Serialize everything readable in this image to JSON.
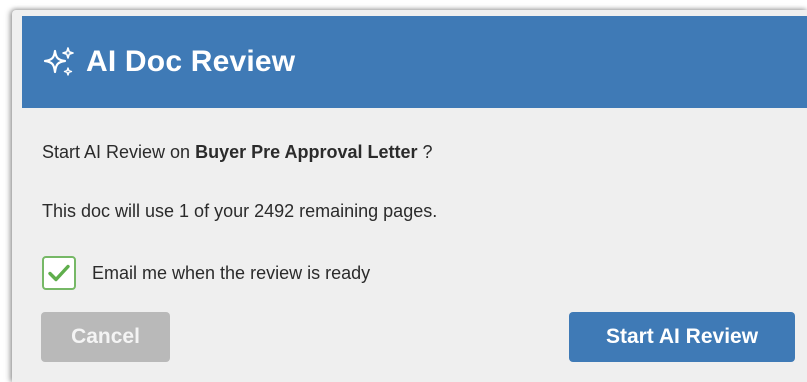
{
  "dialog": {
    "title": "AI Doc Review",
    "icon": "sparkles-icon",
    "prompt_prefix": "Start AI Review on ",
    "doc_name": "Buyer Pre Approval Letter",
    "prompt_suffix": " ?",
    "usage_text": "This doc will use 1 of your 2492 remaining pages.",
    "email_checkbox": {
      "label": "Email me when the review is ready",
      "checked": true
    },
    "cancel_label": "Cancel",
    "start_label": "Start AI Review"
  },
  "colors": {
    "header_bg": "#3f7ab6",
    "primary_button": "#3f7ab6",
    "cancel_button": "#b9b9b9",
    "checkmark": "#5fae4c",
    "panel_bg": "#efefef"
  }
}
